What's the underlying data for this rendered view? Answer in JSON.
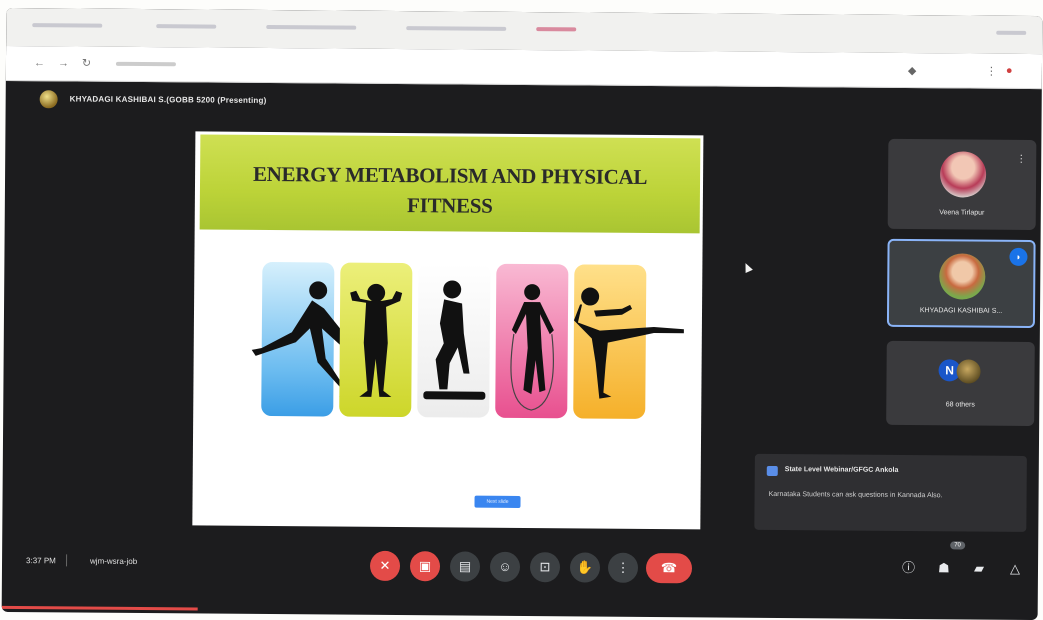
{
  "meeting": {
    "presenter_title": "KHYADAGI KASHIBAI S.(GOBB 5200 (Presenting)",
    "time": "3:37 PM",
    "code": "wjm-wsra-job"
  },
  "slide": {
    "title": "ENERGY METABOLISM AND PHYSICAL\nFITNESS",
    "button_label": "Next slide",
    "panels": [
      {
        "name": "running",
        "color_top": "#bfe6fb",
        "color_bottom": "#3b9ee6"
      },
      {
        "name": "dumbbells",
        "color_top": "#e6ea5e",
        "color_bottom": "#c9d21f"
      },
      {
        "name": "stepper",
        "color_top": "#ffffff",
        "color_bottom": "#e5e5e5"
      },
      {
        "name": "jump-rope",
        "color_top": "#f7a8c8",
        "color_bottom": "#e8448a"
      },
      {
        "name": "kick",
        "color_top": "#ffd96a",
        "color_bottom": "#f4a81f"
      }
    ]
  },
  "participants": [
    {
      "name": "Veena Tirlapur"
    },
    {
      "name": "KHYADAGI KASHIBAI S..."
    },
    {
      "name": "68 others",
      "initial": "N"
    }
  ],
  "chat": {
    "sender": "State Level Webinar/GFGC Ankola",
    "message": "Karnataka Students can ask questions in Kannada Also."
  },
  "controls": {
    "mic_icon": "mic-off-icon",
    "cam_icon": "camera-off-icon",
    "captions_icon": "captions-icon",
    "emoji_icon": "emoji-icon",
    "present_icon": "present-icon",
    "raise_hand_icon": "raise-hand-icon",
    "more_icon": "more-icon",
    "leave_icon": "leave-call-icon",
    "participant_count": "70"
  },
  "colors": {
    "slide_band": "#c3d93f",
    "speaking_border": "#8ab4f8",
    "danger": "#e34b48"
  }
}
